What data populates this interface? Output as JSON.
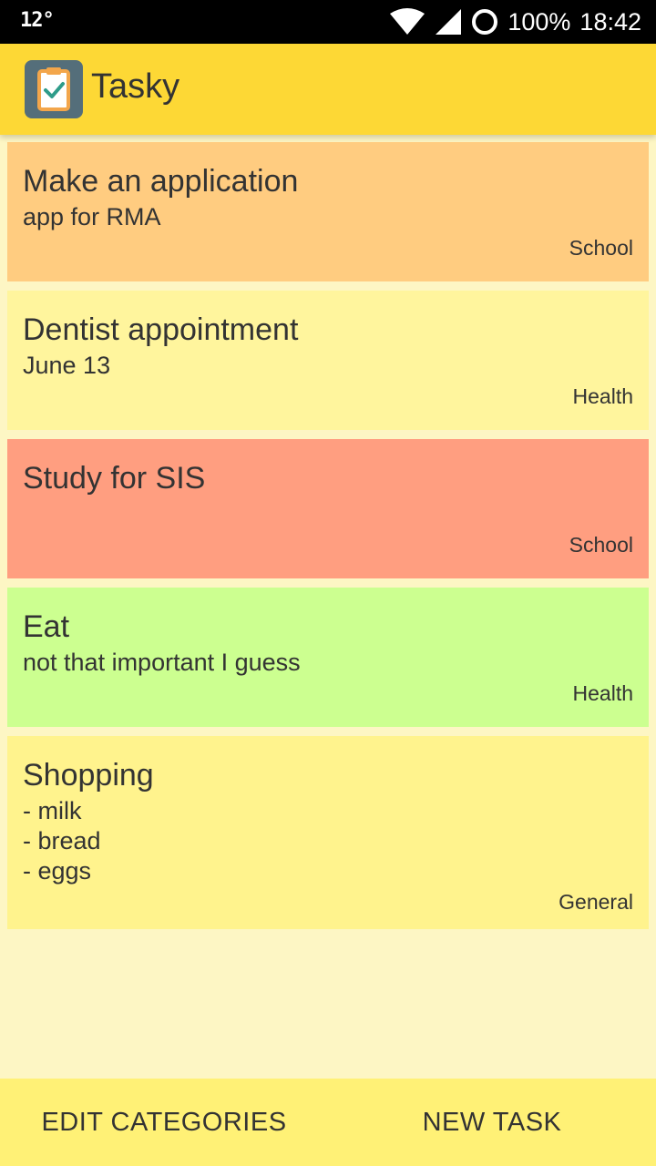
{
  "status_bar": {
    "temperature": "12°",
    "battery": "100%",
    "time": "18:42"
  },
  "app_bar": {
    "title": "Tasky",
    "icon": "clipboard-check-icon"
  },
  "tasks": [
    {
      "title": "Make an application",
      "description": "app for RMA",
      "category": "School",
      "color": "#ffcc80"
    },
    {
      "title": "Dentist appointment",
      "description": "June 13",
      "category": "Health",
      "color": "#fff59d"
    },
    {
      "title": "Study for SIS",
      "description": "",
      "category": "School",
      "color": "#ff9e80"
    },
    {
      "title": "Eat",
      "description": "not that important I guess",
      "category": "Health",
      "color": "#ccff90"
    },
    {
      "title": "Shopping",
      "description": "- milk\n- bread\n- eggs",
      "category": "General",
      "color": "#fff38d"
    }
  ],
  "bottom_bar": {
    "edit_categories_label": "EDIT CATEGORIES",
    "new_task_label": "NEW TASK"
  },
  "colors": {
    "app_bar": "#fdd835",
    "background": "#fdf6c4",
    "bottom_bar": "#fff176"
  }
}
